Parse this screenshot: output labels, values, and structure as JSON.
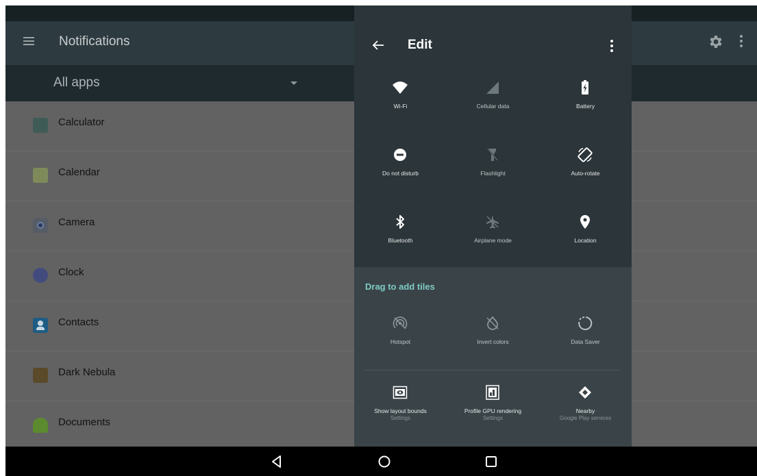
{
  "background_app": {
    "title": "Notifications",
    "filter": {
      "selected": "All apps"
    },
    "apps": [
      {
        "name": "Calculator",
        "icon": "calculator-icon",
        "color": "#3f5b55"
      },
      {
        "name": "Calendar",
        "icon": "calendar-icon",
        "color": "#7f8a5a"
      },
      {
        "name": "Camera",
        "icon": "camera-icon",
        "color": "#555c66"
      },
      {
        "name": "Clock",
        "icon": "clock-icon",
        "color": "#424b7e"
      },
      {
        "name": "Contacts",
        "icon": "contacts-icon",
        "color": "#1d5d85"
      },
      {
        "name": "Dark Nebula",
        "icon": "dark-nebula-icon",
        "color": "#5a4a2a"
      },
      {
        "name": "Documents",
        "icon": "android-icon",
        "color": "#5c8a2e"
      }
    ]
  },
  "panel": {
    "title": "Edit",
    "active_tiles": [
      {
        "label": "Wi-Fi",
        "icon": "wifi-icon",
        "active": true
      },
      {
        "label": "Cellular data",
        "icon": "cellular-icon",
        "active": false
      },
      {
        "label": "Battery",
        "icon": "battery-icon",
        "active": true
      },
      {
        "label": "Do not disturb",
        "icon": "do-not-disturb-icon",
        "active": true
      },
      {
        "label": "Flashlight",
        "icon": "flashlight-icon",
        "active": false
      },
      {
        "label": "Auto-rotate",
        "icon": "auto-rotate-icon",
        "active": true
      },
      {
        "label": "Bluetooth",
        "icon": "bluetooth-icon",
        "active": true
      },
      {
        "label": "Airplane mode",
        "icon": "airplane-icon",
        "active": false
      },
      {
        "label": "Location",
        "icon": "location-icon",
        "active": true
      }
    ],
    "drag_label": "Drag to add tiles",
    "available_tiles": [
      {
        "label": "Hotspot",
        "sub": "",
        "icon": "hotspot-icon"
      },
      {
        "label": "Invert colors",
        "sub": "",
        "icon": "invert-colors-icon"
      },
      {
        "label": "Data Saver",
        "sub": "",
        "icon": "data-saver-icon"
      },
      {
        "label": "Show layout bounds",
        "sub": "Settings",
        "icon": "layout-bounds-icon"
      },
      {
        "label": "Profile GPU rendering",
        "sub": "Settings",
        "icon": "gpu-rendering-icon"
      },
      {
        "label": "Nearby",
        "sub": "Google Play services",
        "icon": "nearby-icon"
      }
    ]
  },
  "colors": {
    "accent": "#7fcbc4",
    "panel_bg": "#3a4448",
    "panel_top_bg": "#2c3539"
  }
}
